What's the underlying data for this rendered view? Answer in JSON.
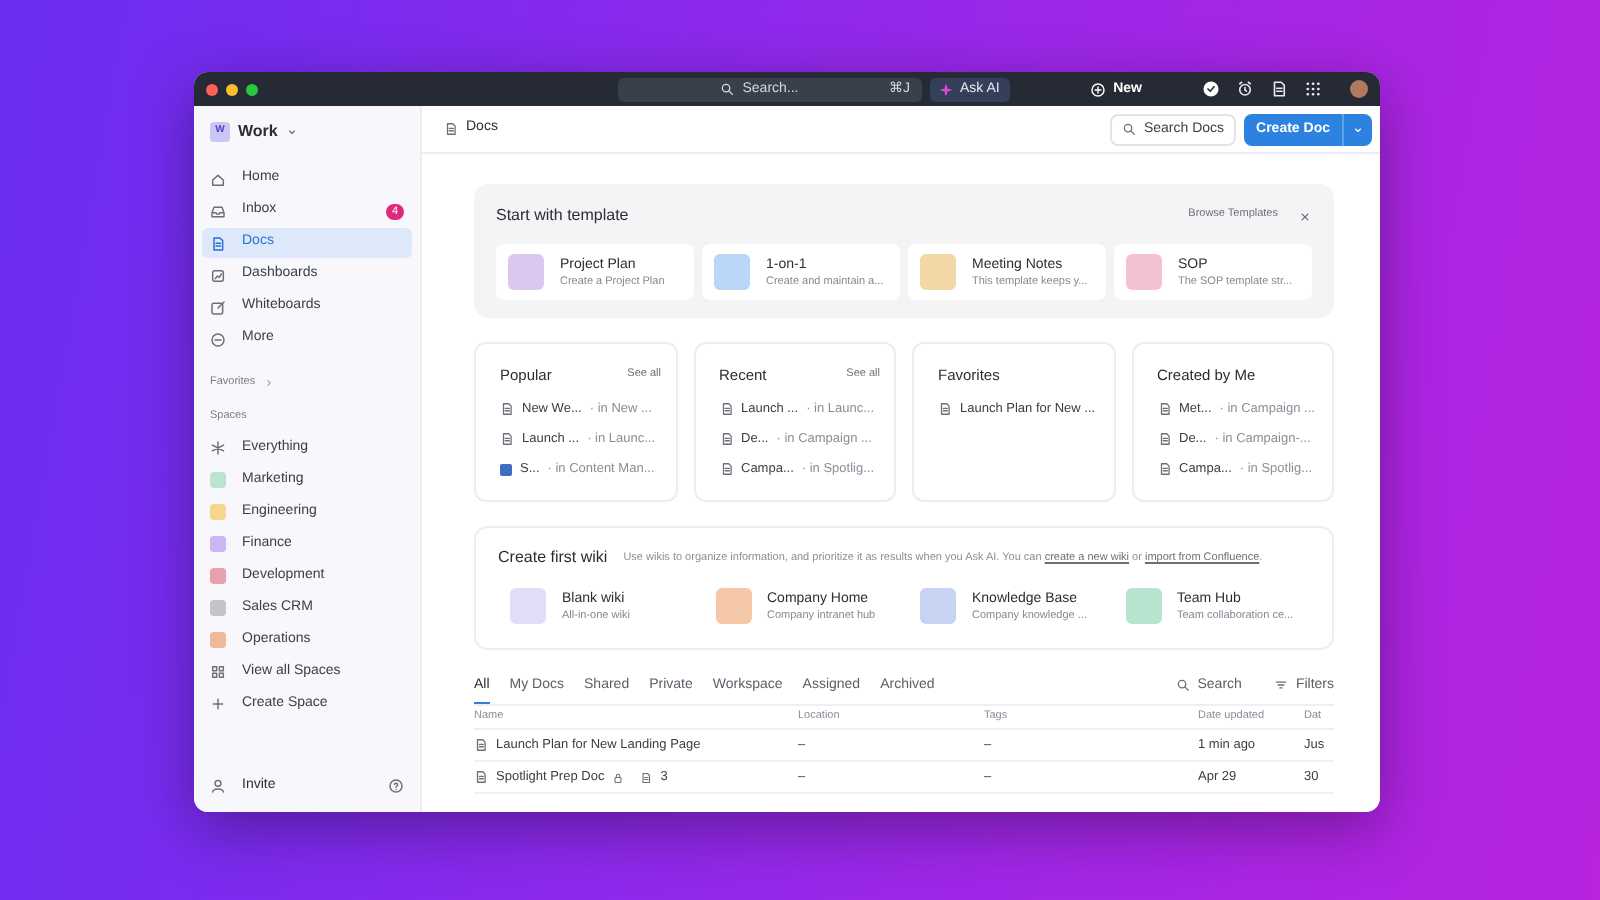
{
  "title_bar": {
    "search_placeholder": "Search...",
    "shortcut": "⌘J",
    "ask_ai": "Ask AI",
    "new_button": "New"
  },
  "sidebar": {
    "workspace": {
      "initial": "W",
      "name": "Work"
    },
    "items": [
      {
        "label": "Home",
        "selected": false
      },
      {
        "label": "Inbox",
        "selected": false,
        "badge": "4"
      },
      {
        "label": "Docs",
        "selected": true
      },
      {
        "label": "Dashboards",
        "selected": false
      },
      {
        "label": "Whiteboards",
        "selected": false
      },
      {
        "label": "More",
        "selected": false
      }
    ],
    "favorites_label": "Favorites",
    "spaces_label": "Spaces",
    "spaces": [
      {
        "kind": "all",
        "label": "Everything"
      },
      {
        "kind": "space",
        "label": "Marketing",
        "color": "#b9e4cf"
      },
      {
        "kind": "space",
        "label": "Engineering",
        "color": "#f6d58e"
      },
      {
        "kind": "space",
        "label": "Finance",
        "color": "#c9b8f0"
      },
      {
        "kind": "space",
        "label": "Development",
        "color": "#e7a3ad"
      },
      {
        "kind": "space",
        "label": "Sales CRM",
        "color": "#c4c4c8"
      },
      {
        "kind": "space",
        "label": "Operations",
        "color": "#f0b79a"
      },
      {
        "kind": "view",
        "label": "View all Spaces"
      },
      {
        "kind": "create",
        "label": "Create Space"
      }
    ],
    "invite": "Invite"
  },
  "header": {
    "breadcrumb": "Docs",
    "search_docs": "Search Docs",
    "create_doc": "Create Doc"
  },
  "templates": {
    "title": "Start with template",
    "browse": "Browse Templates",
    "items": [
      {
        "title": "Project Plan",
        "subtitle": "Create a Project Plan",
        "color": "#dcc6f2"
      },
      {
        "title": "1-on-1",
        "subtitle": "Create and maintain a...",
        "color": "#bcd6f7"
      },
      {
        "title": "Meeting Notes",
        "subtitle": "This template keeps y...",
        "color": "#f3d7a6"
      },
      {
        "title": "SOP",
        "subtitle": "The SOP template str...",
        "color": "#f4c1d3"
      }
    ]
  },
  "lists": [
    {
      "title": "Popular",
      "see_all": "See all",
      "docs": [
        {
          "kind": "doc",
          "name": "New We...",
          "location": "· in New ..."
        },
        {
          "kind": "doc",
          "name": "Launch ...",
          "location": "· in Launc..."
        },
        {
          "kind": "space",
          "name": "S...",
          "location": "· in Content Man..."
        }
      ]
    },
    {
      "title": "Recent",
      "see_all": "See all",
      "docs": [
        {
          "kind": "doc",
          "name": "Launch ...",
          "location": "· in Launc..."
        },
        {
          "kind": "doc",
          "name": "De...",
          "location": "· in Campaign ..."
        },
        {
          "kind": "doc",
          "name": "Campa...",
          "location": "· in Spotlig..."
        }
      ]
    },
    {
      "title": "Favorites",
      "docs": [
        {
          "kind": "doc",
          "name": "Launch Plan for New ..."
        }
      ]
    },
    {
      "title": "Created by Me",
      "docs": [
        {
          "kind": "doc",
          "name": "Met...",
          "location": "· in Campaign ..."
        },
        {
          "kind": "doc",
          "name": "De...",
          "location": "· in Campaign-..."
        },
        {
          "kind": "doc",
          "name": "Campa...",
          "location": "· in Spotlig..."
        }
      ]
    }
  ],
  "wiki": {
    "title": "Create first wiki",
    "description": [
      {
        "text": "Use wikis to organize information, and prioritize it as results when you Ask AI. You can ",
        "link": false
      },
      {
        "text": "create a new wiki",
        "link": true
      },
      {
        "text": " or ",
        "link": false
      },
      {
        "text": "import from Confluence",
        "link": true
      },
      {
        "text": ".",
        "link": false
      }
    ],
    "items": [
      {
        "title": "Blank wiki",
        "subtitle": "All-in-one wiki",
        "color": "#e2dcf7"
      },
      {
        "title": "Company Home",
        "subtitle": "Company intranet hub",
        "color": "#f5c9a8"
      },
      {
        "title": "Knowledge Base",
        "subtitle": "Company knowledge ...",
        "color": "#c8d3f4"
      },
      {
        "title": "Team Hub",
        "subtitle": "Team collaboration ce...",
        "color": "#b7e4cf"
      }
    ]
  },
  "tabs": [
    {
      "label": "All",
      "selected": true
    },
    {
      "label": "My Docs",
      "selected": false
    },
    {
      "label": "Shared",
      "selected": false
    },
    {
      "label": "Private",
      "selected": false
    },
    {
      "label": "Workspace",
      "selected": false
    },
    {
      "label": "Assigned",
      "selected": false
    },
    {
      "label": "Archived",
      "selected": false
    }
  ],
  "table_search": "Search",
  "filters": "Filters",
  "table": {
    "columns": [
      "Name",
      "Location",
      "Tags",
      "Date updated",
      "Dat"
    ],
    "rows": [
      {
        "name": "Launch Plan for New Landing Page",
        "locked": false,
        "location": "–",
        "tags": "–",
        "date_updated": "1 min ago",
        "column_5": "Jus"
      },
      {
        "name": "Spotlight Prep Doc",
        "locked": true,
        "doc_count": "3",
        "location": "–",
        "tags": "–",
        "date_updated": "Apr 29",
        "column_5": "30"
      }
    ]
  }
}
